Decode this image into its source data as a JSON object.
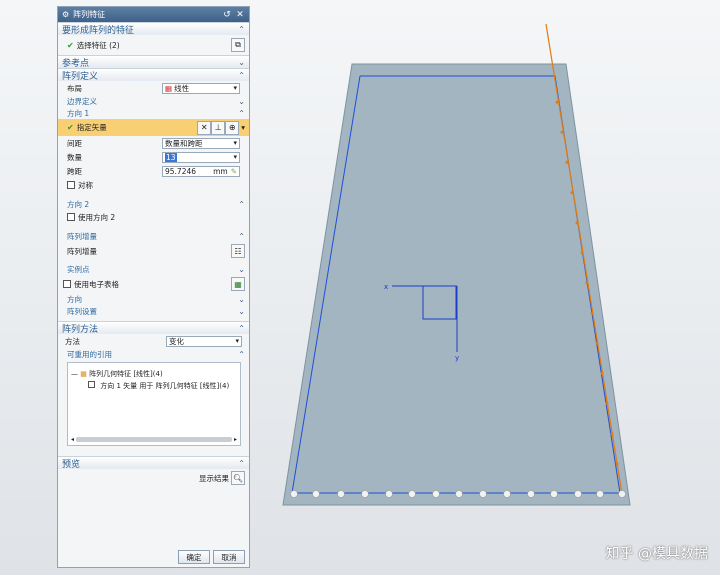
{
  "dialog": {
    "title": "阵列特征",
    "features_section": {
      "title": "要形成阵列的特征",
      "select_label": "选择特征 (2)"
    },
    "reference_section": {
      "title": "参考点"
    },
    "pattern_def": {
      "title": "阵列定义",
      "layout_label": "布局",
      "layout_value": "线性",
      "boundary": "边界定义",
      "dir1": {
        "title": "方向 1",
        "vector_label": "指定矢量",
        "spacing_label": "间距",
        "spacing_value": "数量和跨距",
        "count_label": "数量",
        "count_value": "13",
        "pitch_label": "跨距",
        "pitch_value": "95.7246",
        "pitch_unit": "mm",
        "symmetric_label": "对称"
      },
      "dir2": {
        "title": "方向 2",
        "use_label": "使用方向 2"
      },
      "increment": {
        "title": "阵列增量",
        "label": "阵列增量"
      },
      "instance": {
        "title": "实例点"
      },
      "spreadsheet_label": "使用电子表格",
      "orientation": {
        "title": "方向"
      },
      "settings": {
        "title": "阵列设置"
      }
    },
    "method": {
      "title": "阵列方法",
      "method_label": "方法",
      "method_value": "变化",
      "reuse_title": "可重用的引用",
      "tree_items": [
        "阵列几何特征 [线性](4)",
        "方向 1 矢量 用于 阵列几何特征 [线性](4)"
      ]
    },
    "preview": {
      "title": "预览",
      "show_result": "显示结果"
    },
    "buttons": {
      "ok": "确定",
      "cancel": "取消"
    }
  },
  "viewport": {
    "axis_x": "x",
    "axis_y": "y",
    "plate_color": "#9fb3bf",
    "orange": "#e07b12"
  },
  "watermark": "知乎 @模具数据"
}
